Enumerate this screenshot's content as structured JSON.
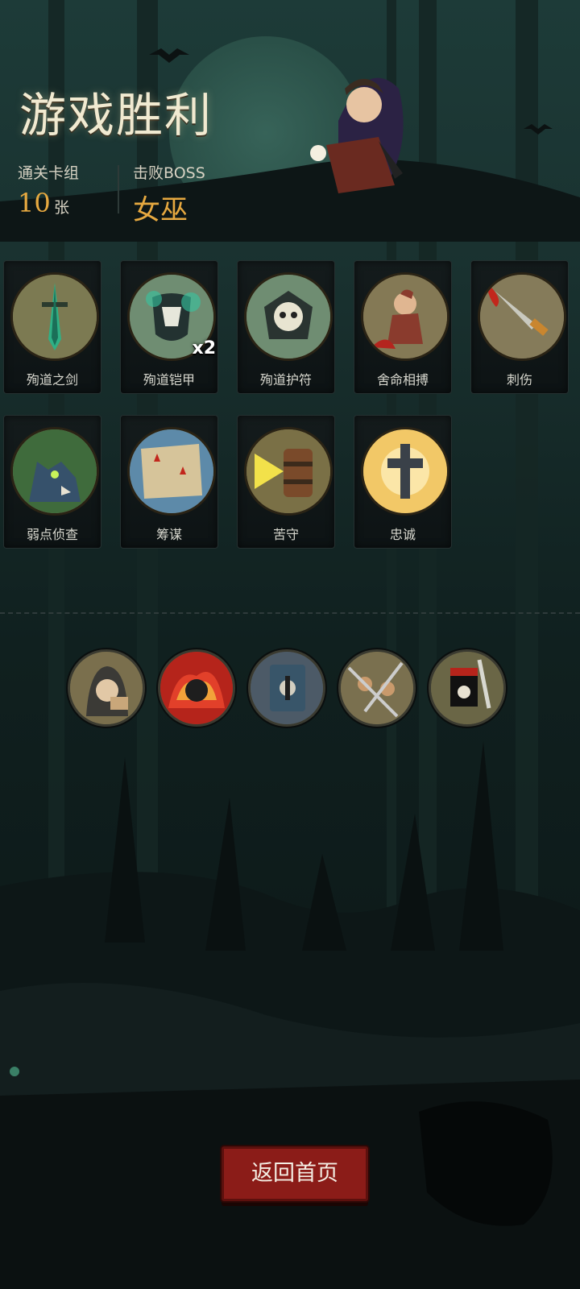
{
  "header": {
    "title": "游戏胜利",
    "deck_label": "通关卡组",
    "deck_count": "10",
    "deck_unit": "张",
    "boss_label": "击败BOSS",
    "boss_name": "女巫"
  },
  "cards": [
    {
      "label": "殉道之剑",
      "icon": "sword-icon",
      "badge": ""
    },
    {
      "label": "殉道铠甲",
      "icon": "armor-icon",
      "badge": "x2"
    },
    {
      "label": "殉道护符",
      "icon": "skull-amulet-icon",
      "badge": ""
    },
    {
      "label": "舍命相搏",
      "icon": "desperate-fight-icon",
      "badge": ""
    },
    {
      "label": "刺伤",
      "icon": "dagger-icon",
      "badge": ""
    },
    {
      "label": "弱点侦查",
      "icon": "wolf-icon",
      "badge": ""
    },
    {
      "label": "筹谋",
      "icon": "map-icon",
      "badge": ""
    },
    {
      "label": "苦守",
      "icon": "shield-bracer-icon",
      "badge": ""
    },
    {
      "label": "忠诚",
      "icon": "cross-icon",
      "badge": ""
    }
  ],
  "relics": [
    {
      "icon": "hooded-merchant-icon"
    },
    {
      "icon": "fire-mask-icon"
    },
    {
      "icon": "tome-icon"
    },
    {
      "icon": "warrior-crowd-icon"
    },
    {
      "icon": "banner-sword-icon"
    }
  ],
  "footer": {
    "home_button": "返回首页"
  },
  "colors": {
    "accent_gold": "#e7a940",
    "button_red": "#8b1c18",
    "background": "#0f1a1a"
  }
}
